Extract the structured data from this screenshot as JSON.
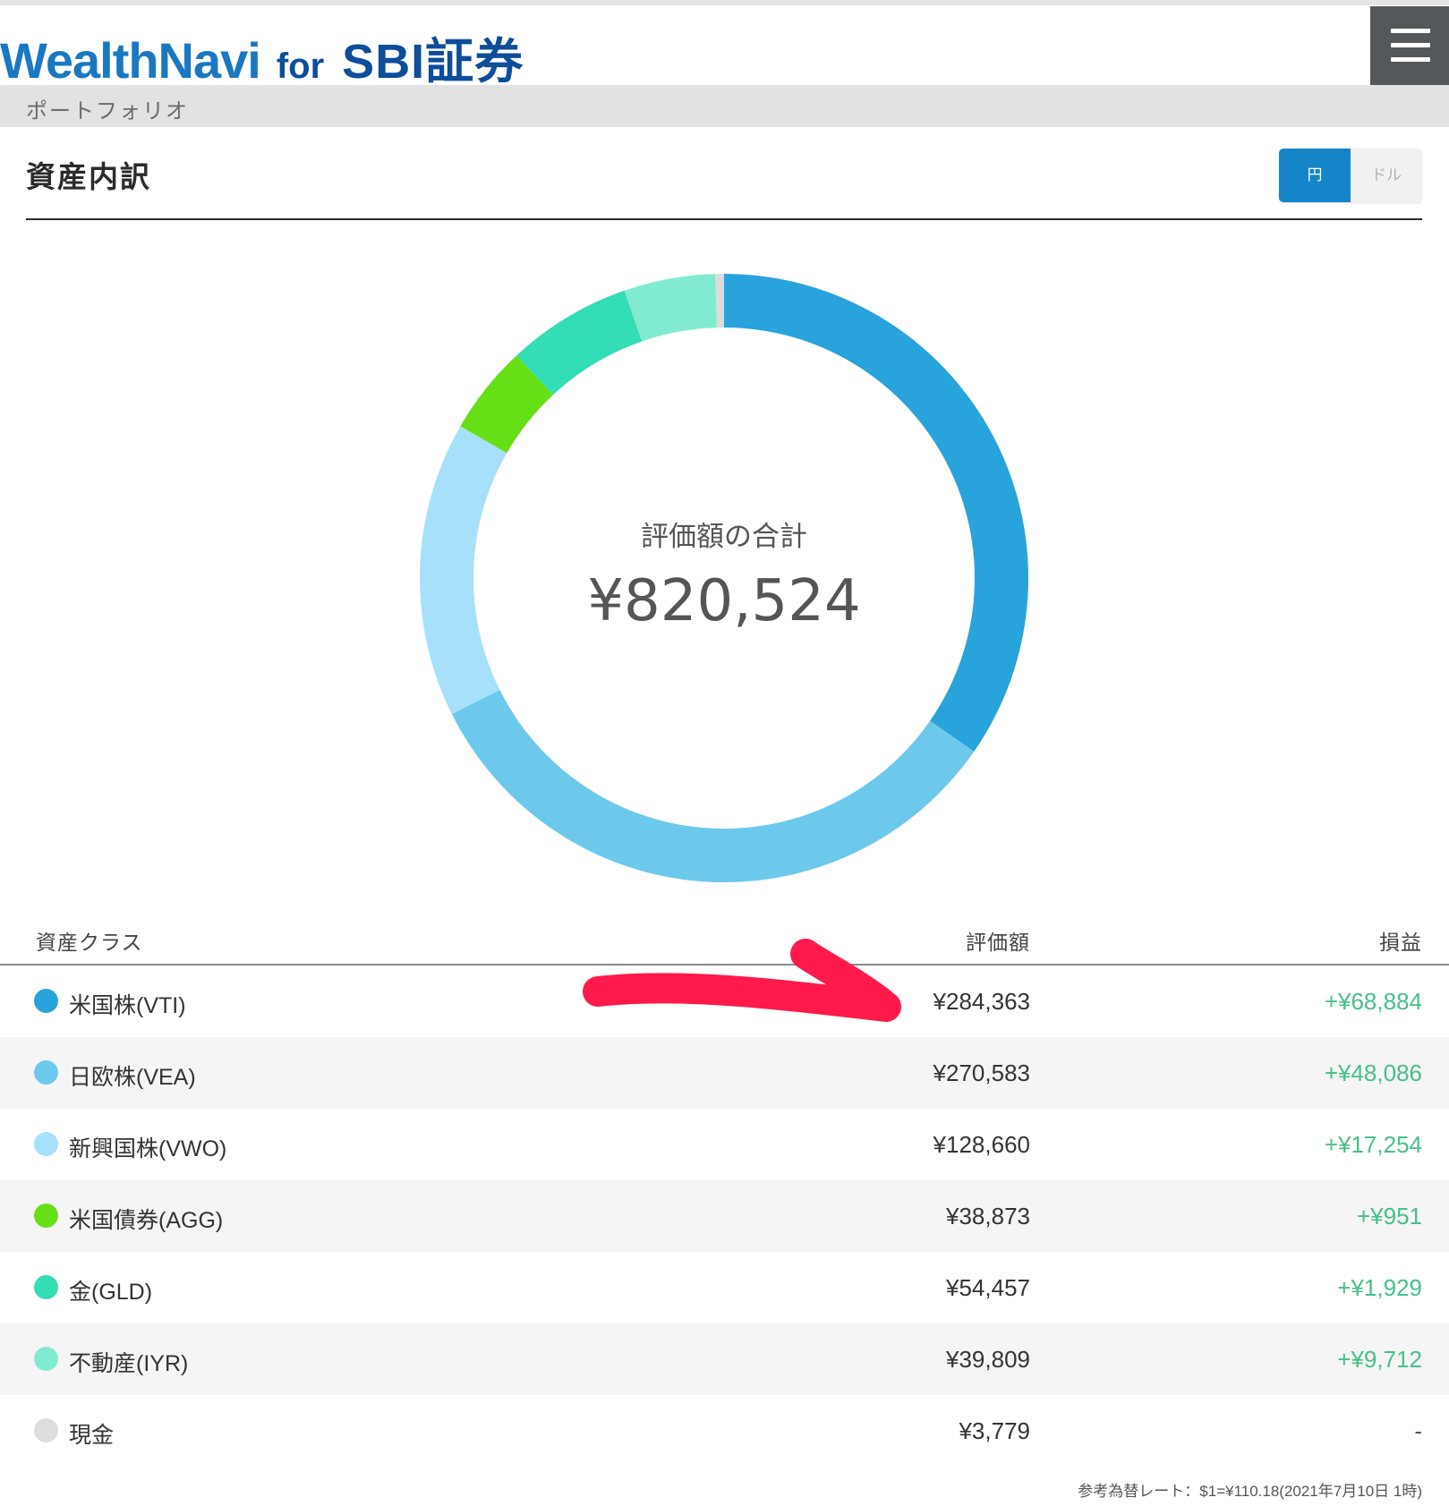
{
  "header": {
    "logo_main": "WealthNavi",
    "logo_for": "for",
    "logo_partner": "SBI証券",
    "menu_icon": "hamburger-icon"
  },
  "breadcrumb": "ポートフォリオ",
  "section": {
    "title": "資産内訳",
    "currency_toggle": {
      "yen_label": "円",
      "dollar_label": "ドル",
      "selected": "円"
    }
  },
  "donut": {
    "center_label": "評価額の合計",
    "center_value": "¥820,524"
  },
  "table": {
    "headers": {
      "asset_class": "資産クラス",
      "value": "評価額",
      "profit": "損益"
    },
    "rows": [
      {
        "name": "米国株(VTI)",
        "value": "¥284,363",
        "profit": "+¥68,884",
        "color": "#29a3dc",
        "amount": 284363
      },
      {
        "name": "日欧株(VEA)",
        "value": "¥270,583",
        "profit": "+¥48,086",
        "color": "#6dc9ec",
        "amount": 270583
      },
      {
        "name": "新興国株(VWO)",
        "value": "¥128,660",
        "profit": "+¥17,254",
        "color": "#a6e0fb",
        "amount": 128660
      },
      {
        "name": "米国債券(AGG)",
        "value": "¥38,873",
        "profit": "+¥951",
        "color": "#66e016",
        "amount": 38873
      },
      {
        "name": "金(GLD)",
        "value": "¥54,457",
        "profit": "+¥1,929",
        "color": "#33ddb5",
        "amount": 54457
      },
      {
        "name": "不動産(IYR)",
        "value": "¥39,809",
        "profit": "+¥9,712",
        "color": "#80ebd0",
        "amount": 39809
      },
      {
        "name": "現金",
        "value": "¥3,779",
        "profit": "-",
        "color": "#dddddd",
        "amount": 3779
      }
    ]
  },
  "footnote": "参考為替レート：$1=¥110.18(2021年7月10日 1時)",
  "annotation": {
    "color": "#ff1a4b",
    "shape": "hand-drawn-arrow"
  },
  "colors": {
    "accent": "#1684c8",
    "profit_positive": "#46c08a",
    "menu_bg": "#55585b"
  }
}
